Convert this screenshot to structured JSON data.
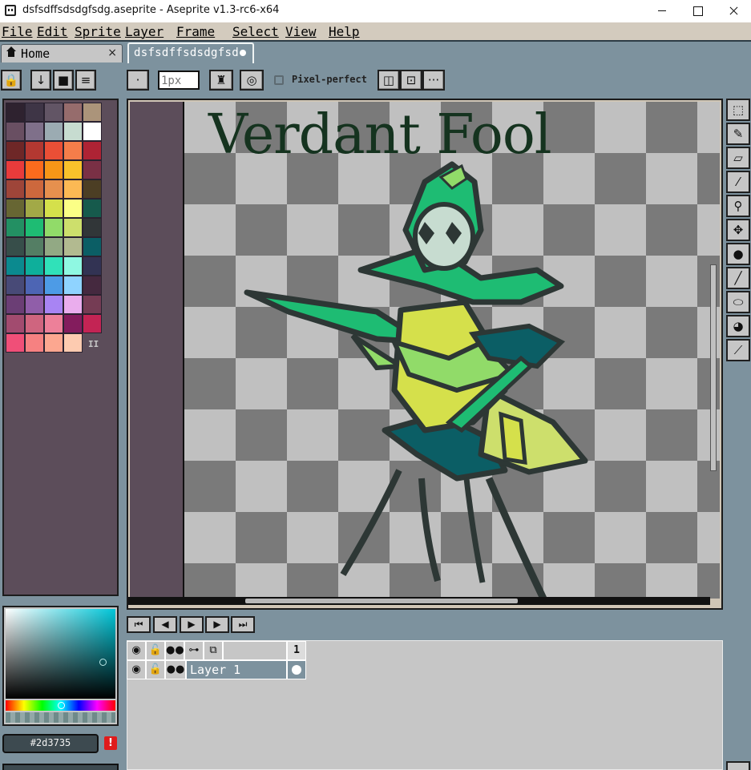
{
  "window": {
    "title": "dsfsdffsdsdgfsdg.aseprite - Aseprite v1.3-rc6-x64"
  },
  "menu": [
    "File",
    "Edit",
    "Sprite",
    "Layer",
    "Frame",
    "Select",
    "View",
    "Help"
  ],
  "tabs": {
    "home": {
      "label": "Home",
      "close": "×"
    },
    "document": {
      "label": "dsfsdffsdsdgfsd",
      "modified": true
    }
  },
  "toolbar": {
    "brush_size_placeholder": "1px",
    "pixel_perfect_label": "Pixel-perfect",
    "pixel_perfect_checked": false,
    "more_label": "···"
  },
  "palette": {
    "colors": [
      "#2e222f",
      "#3e3546",
      "#625565",
      "#966c6c",
      "#ab947a",
      "#694f62",
      "#7f708a",
      "#9babb2",
      "#c7dcd0",
      "#ffffff",
      "#6e2727",
      "#b33831",
      "#ea4f36",
      "#f57d4a",
      "#ae2334",
      "#e83b3b",
      "#fb6b1d",
      "#f79617",
      "#f9c22b",
      "#7a3045",
      "#9e4539",
      "#cd683d",
      "#e6904e",
      "#fbb954",
      "#4c3e24",
      "#676633",
      "#a2a947",
      "#d5e04b",
      "#fbff86",
      "#165a4c",
      "#239063",
      "#1ebc73",
      "#91db69",
      "#cddf6c",
      "#313638",
      "#374e4a",
      "#547e64",
      "#92a984",
      "#b2ba90",
      "#0b5e65",
      "#0b8a8f",
      "#0eaf9b",
      "#30e1b9",
      "#8ff8e2",
      "#323353",
      "#484a77",
      "#4d65b4",
      "#4d9be6",
      "#8fd3ff",
      "#45293f",
      "#6b3e75",
      "#905ea9",
      "#a884f3",
      "#eaaded",
      "#753c54",
      "#a24b6f",
      "#cf657f",
      "#ed8099",
      "#831c5d",
      "#c32454",
      "#f04f78",
      "#f68181",
      "#fca790",
      "#fdcbb0"
    ],
    "grip": "II"
  },
  "color": {
    "hex": "#2d3735",
    "warning": "!"
  },
  "canvas": {
    "sprite_text": "Verdant Fool"
  },
  "tools": [
    {
      "name": "rectangular-marquee-icon",
      "glyph": "⬚"
    },
    {
      "name": "pencil-icon",
      "glyph": "✎"
    },
    {
      "name": "eraser-icon",
      "glyph": "▱"
    },
    {
      "name": "eyedropper-icon",
      "glyph": "⁄"
    },
    {
      "name": "zoom-icon",
      "glyph": "⚲"
    },
    {
      "name": "move-icon",
      "glyph": "✥"
    },
    {
      "name": "paint-bucket-icon",
      "glyph": "●"
    },
    {
      "name": "line-icon",
      "glyph": "╱"
    },
    {
      "name": "ellipse-icon",
      "glyph": "⬭"
    },
    {
      "name": "contour-icon",
      "glyph": "◕"
    },
    {
      "name": "blur-icon",
      "glyph": "⟋"
    }
  ],
  "timeline": {
    "buttons": [
      "⏮",
      "◀",
      "▶",
      "▶",
      "⏭"
    ],
    "frame_number": "1",
    "layers": [
      {
        "name": "Layer 1",
        "visible": true,
        "locked": false
      }
    ]
  }
}
